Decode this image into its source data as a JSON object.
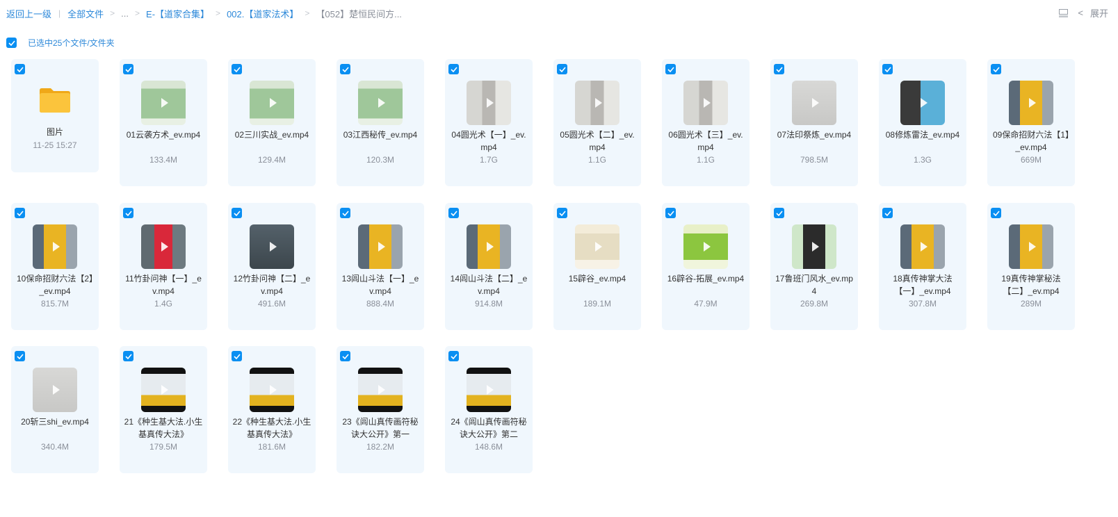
{
  "breadcrumb": {
    "back": "返回上一级",
    "all_files": "全部文件",
    "ellipsis": "...",
    "sep": ">",
    "level1": "E-【道家合集】",
    "level2": "002.【道家法术】",
    "current": "【052】楚恒民间方..."
  },
  "top_right": {
    "expand_label": "展开",
    "chevron": "<",
    "view_icon": "layout-icon"
  },
  "selection": {
    "label": "已选中25个文件/文件夹",
    "checked": true
  },
  "colors": {
    "accent": "#0a8ff2",
    "link": "#2c88d9",
    "card_bg": "#f0f7fd",
    "folder": "#f7b731"
  },
  "files": [
    {
      "name": "图片",
      "meta": "11-25 15:27",
      "kind": "folder"
    },
    {
      "name": "01云袭方术_ev.mp4",
      "meta": "133.4M",
      "kind": "video",
      "thumb": "slides-green"
    },
    {
      "name": "02三川实战_ev.mp4",
      "meta": "129.4M",
      "kind": "video",
      "thumb": "slides-green"
    },
    {
      "name": "03江西秘传_ev.mp4",
      "meta": "120.3M",
      "kind": "video",
      "thumb": "slides-green"
    },
    {
      "name": "04圆光术【一】_ev.mp4",
      "meta": "1.7G",
      "kind": "video",
      "thumb": "person-white"
    },
    {
      "name": "05圆光术【二】_ev.mp4",
      "meta": "1.1G",
      "kind": "video",
      "thumb": "person-white"
    },
    {
      "name": "06圆光术【三】_ev.mp4",
      "meta": "1.1G",
      "kind": "video",
      "thumb": "person-white"
    },
    {
      "name": "07法印祭炼_ev.mp4",
      "meta": "798.5M",
      "kind": "video",
      "thumb": "whiteboard-gray"
    },
    {
      "name": "08修炼雷法_ev.mp4",
      "meta": "1.3G",
      "kind": "video",
      "thumb": "person-board"
    },
    {
      "name": "09保命招财六法【1】_ev.mp4",
      "meta": "669M",
      "kind": "video",
      "thumb": "person-yellow"
    },
    {
      "name": "10保命招财六法【2】_ev.mp4",
      "meta": "815.7M",
      "kind": "video",
      "thumb": "person-yellow"
    },
    {
      "name": "11竹卦问神【一】_ev.mp4",
      "meta": "1.4G",
      "kind": "video",
      "thumb": "person-red"
    },
    {
      "name": "12竹卦问神【二】_ev.mp4",
      "meta": "491.6M",
      "kind": "video",
      "thumb": "hands-board"
    },
    {
      "name": "13闾山斗法【一】_ev.mp4",
      "meta": "888.4M",
      "kind": "video",
      "thumb": "person-yellow"
    },
    {
      "name": "14闾山斗法【二】_ev.mp4",
      "meta": "914.8M",
      "kind": "video",
      "thumb": "person-yellow"
    },
    {
      "name": "15辟谷_ev.mp4",
      "meta": "189.1M",
      "kind": "video",
      "thumb": "slides-cream"
    },
    {
      "name": "16辟谷-拓展_ev.mp4",
      "meta": "47.9M",
      "kind": "video",
      "thumb": "slides-lime"
    },
    {
      "name": "17鲁班门风水_ev.mp4",
      "meta": "269.8M",
      "kind": "video",
      "thumb": "phone-green"
    },
    {
      "name": "18真传神掌大法【一】_ev.mp4",
      "meta": "307.8M",
      "kind": "video",
      "thumb": "person-yellow"
    },
    {
      "name": "19真传神掌秘法【二】_ev.mp4",
      "meta": "289M",
      "kind": "video",
      "thumb": "person-yellow"
    },
    {
      "name": "20斩三shi_ev.mp4",
      "meta": "340.4M",
      "kind": "video",
      "thumb": "whiteboard-gray"
    },
    {
      "name": "21《种生基大法.小生基真传大法》",
      "meta": "179.5M",
      "kind": "video",
      "thumb": "dark-yellow"
    },
    {
      "name": "22《种生基大法.小生基真传大法》",
      "meta": "181.6M",
      "kind": "video",
      "thumb": "dark-yellow"
    },
    {
      "name": "23《闾山真传画符秘诀大公开》第一",
      "meta": "182.2M",
      "kind": "video",
      "thumb": "dark-yellow"
    },
    {
      "name": "24《闾山真传画符秘诀大公开》第二",
      "meta": "148.6M",
      "kind": "video",
      "thumb": "dark-yellow"
    }
  ]
}
